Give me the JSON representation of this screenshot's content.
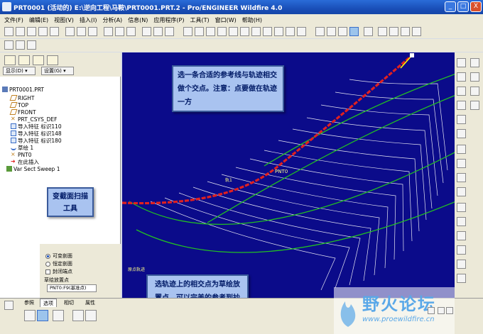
{
  "window": {
    "title": "PRT0001 (活动的) E:\\逆向工程\\马鞍\\PRT0001.PRT.2 - Pro/ENGINEER Wildfire 4.0",
    "min": "_",
    "max": "□",
    "close": "X"
  },
  "menu": [
    "文件(F)",
    "编辑(E)",
    "视图(V)",
    "插入(I)",
    "分析(A)",
    "信息(N)",
    "应用程序(P)",
    "工具(T)",
    "窗口(W)",
    "帮助(H)"
  ],
  "panel": {
    "show_btn": "显示(D) ▾",
    "settings_btn": "设置(G) ▾"
  },
  "tree": [
    {
      "label": "PRT0001.PRT",
      "icon": "part-icon"
    },
    {
      "label": "RIGHT",
      "icon": "datum-plane-icon"
    },
    {
      "label": "TOP",
      "icon": "datum-plane-icon"
    },
    {
      "label": "FRONT",
      "icon": "datum-plane-icon"
    },
    {
      "label": "PRT_CSYS_DEF",
      "icon": "csys-icon"
    },
    {
      "label": "导入特征 标识110",
      "icon": "import-feature-icon"
    },
    {
      "label": "导入特征 标识148",
      "icon": "import-feature-icon"
    },
    {
      "label": "导入特征 标识180",
      "icon": "import-feature-icon"
    },
    {
      "label": "草绘 1",
      "icon": "sketch-icon"
    },
    {
      "label": "PNT0",
      "icon": "datum-point-icon"
    },
    {
      "label": "在此插入",
      "icon": "insert-here-arrow-icon"
    },
    {
      "label": "Var Sect Sweep 1",
      "icon": "sweep-icon"
    }
  ],
  "annotations": {
    "top": "选一条合适的参考线与轨迹相交做个交点。注意：点要做在轨迹一方",
    "left": "变截面扫描工具",
    "bottom": "选轨迹上的相交点为草绘放置点，可以完美的参考到抄数线"
  },
  "options": {
    "radio1": "可变剖面",
    "radio2": "恒定剖面",
    "check": "封闭端点",
    "place_label": "草绘放置点",
    "place_value": "PNT0:F9(基准点)"
  },
  "viewport": {
    "point_label": "PNT0",
    "small_label1": "轨1",
    "small_label2": "原点轨迹"
  },
  "dashboard_tabs": [
    "参照",
    "选项",
    "相切",
    "属性"
  ],
  "watermark": {
    "cn": "野火论坛",
    "url": "www.proewildfire.cn"
  },
  "colors": {
    "viewport_bg": "#0b0b8a",
    "trajectory": "#e02020",
    "ruled_lines": "#ffffff",
    "guide_curves": "#22c022"
  }
}
